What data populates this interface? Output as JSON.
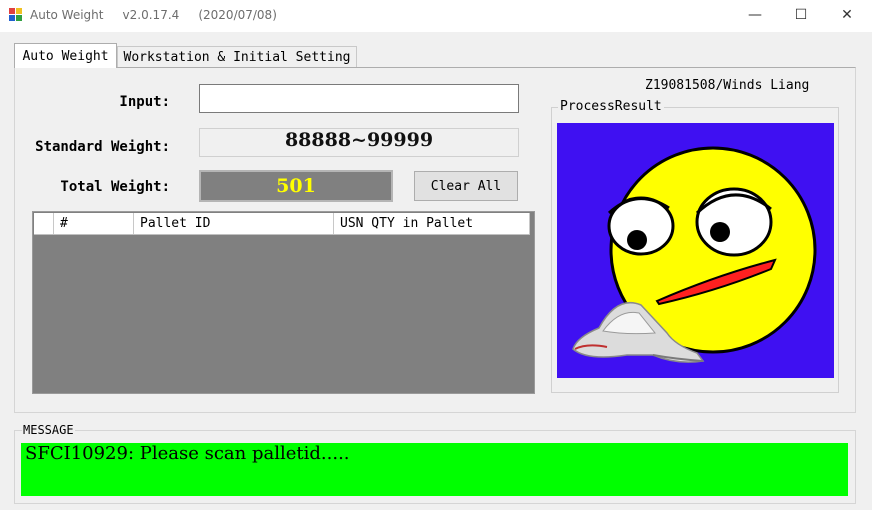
{
  "window": {
    "title": "Auto Weight     v2.0.17.4     (2020/07/08)",
    "controls": [
      "—",
      "☐",
      "✕"
    ]
  },
  "tabs": [
    {
      "label": "Auto Weight",
      "active": true
    },
    {
      "label": "Workstation & Initial Setting",
      "active": false
    }
  ],
  "form": {
    "input_label": "Input:",
    "input_value": "",
    "standard_label": "Standard Weight:",
    "standard_value": "88888~99999",
    "total_label": "Total Weight:",
    "total_value": "501",
    "clear_label": "Clear All"
  },
  "grid": {
    "columns": [
      "#",
      "Pallet ID",
      "USN QTY in Pallet"
    ],
    "rows": []
  },
  "user": "Z19081508/Winds Liang",
  "process_result": {
    "title": "ProcessResult",
    "image": "confused-smiley-with-barcode-scanner"
  },
  "message": {
    "title": "MESSAGE",
    "text": "SFCI10929: Please scan palletid.....",
    "color": "#00ff00"
  },
  "colors": {
    "total_bg": "#808080",
    "total_text": "#ffff00",
    "result_bg": "#3f10f2",
    "face": "#ffff00"
  }
}
